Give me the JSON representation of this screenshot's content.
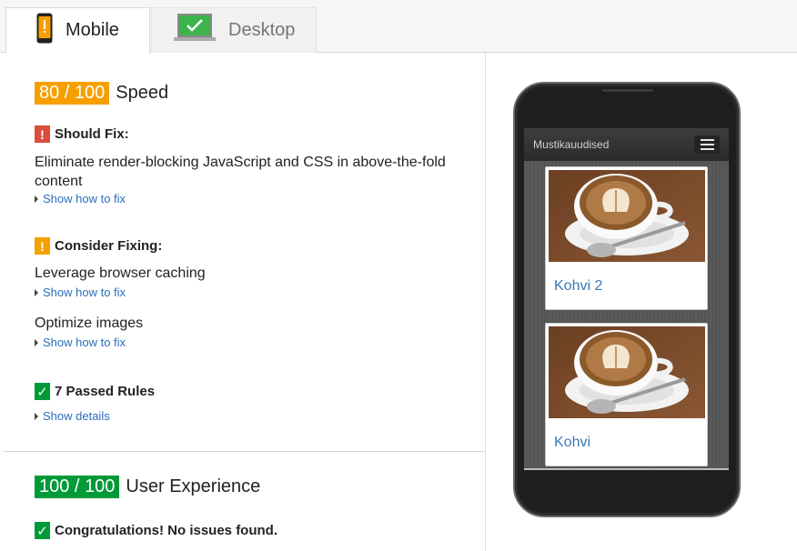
{
  "tabs": [
    {
      "label": "Mobile",
      "active": true,
      "icon": "mobile-phone-icon"
    },
    {
      "label": "Desktop",
      "active": false,
      "icon": "desktop-monitor-icon"
    }
  ],
  "speed": {
    "score": "80 / 100",
    "label": "Speed",
    "should_fix": {
      "header": "Should Fix:",
      "rules": [
        {
          "text": "Eliminate render-blocking JavaScript and CSS in above-the-fold content",
          "link": "Show how to fix"
        }
      ]
    },
    "consider_fixing": {
      "header": "Consider Fixing:",
      "rules": [
        {
          "text": "Leverage browser caching",
          "link": "Show how to fix"
        },
        {
          "text": "Optimize images",
          "link": "Show how to fix"
        }
      ]
    },
    "passed": {
      "header": "7 Passed Rules",
      "link": "Show details"
    }
  },
  "user_experience": {
    "score": "100 / 100",
    "label": "User Experience",
    "message": "Congratulations! No issues found."
  },
  "preview": {
    "app_title": "Mustikauudised",
    "cards": [
      {
        "title": "Kohvi 2"
      },
      {
        "title": "Kohvi"
      }
    ]
  },
  "colors": {
    "orange": "#f5a000",
    "green": "#009a39",
    "red": "#dd4b39",
    "link": "#2a6ebb"
  }
}
